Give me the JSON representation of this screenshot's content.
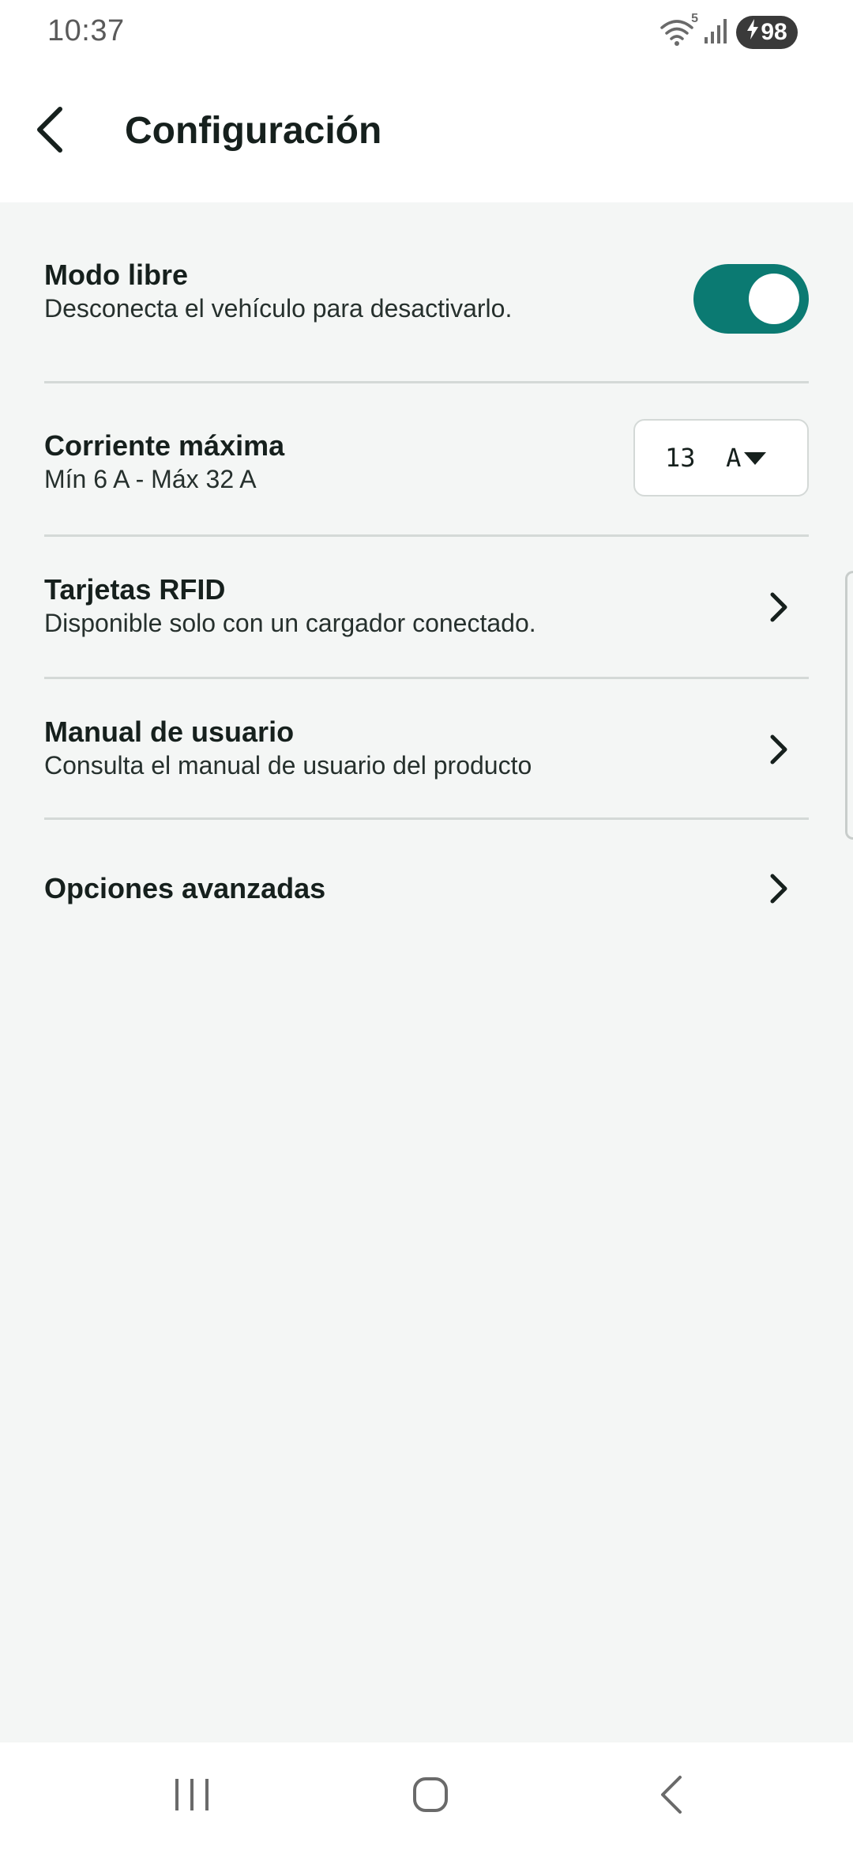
{
  "status_bar": {
    "time": "10:37",
    "wifi_label": "5",
    "battery_level": "98",
    "icons": [
      "wifi-icon",
      "signal-icon",
      "battery-charging-icon"
    ]
  },
  "app_bar": {
    "back_icon": "arrow-left-icon",
    "title": "Configuración"
  },
  "settings": {
    "free_mode": {
      "title": "Modo libre",
      "subtitle": "Desconecta el vehículo para desactivarlo.",
      "enabled": true
    },
    "max_current": {
      "title": "Corriente máxima",
      "subtitle": "Mín 6 A - Máx 32 A",
      "selected": "13  A"
    },
    "rfid_cards": {
      "title": "Tarjetas RFID",
      "subtitle": "Disponible solo con un cargador conectado."
    },
    "user_manual": {
      "title": "Manual de usuario",
      "subtitle": "Consulta el manual de usuario del producto"
    },
    "advanced_options": {
      "title": "Opciones avanzadas"
    }
  },
  "nav_bar": {
    "icons": [
      "recent-apps-icon",
      "home-icon",
      "back-icon"
    ]
  },
  "colors": {
    "accent": "#0b7a72",
    "background": "#f4f6f5",
    "surface": "#ffffff",
    "divider": "#d4d9d7",
    "text": "#16201d"
  }
}
